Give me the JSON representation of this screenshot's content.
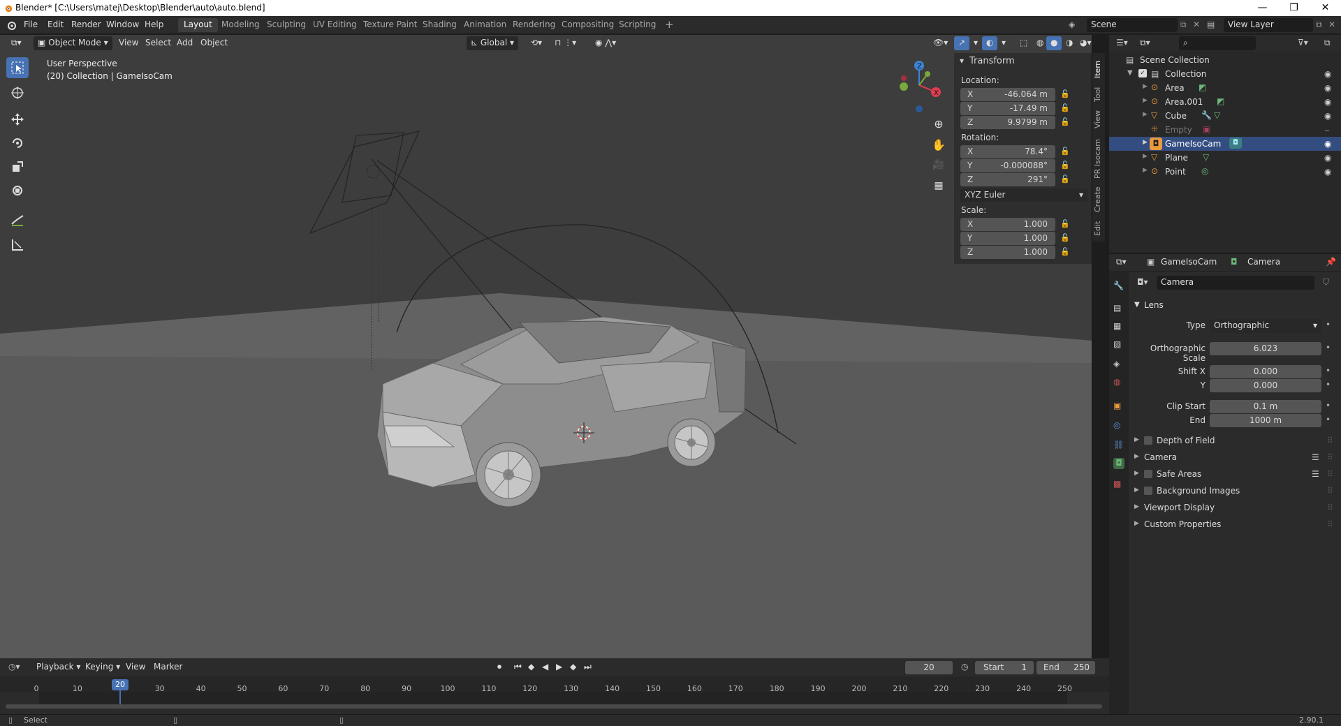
{
  "window": {
    "title": "Blender* [C:\\Users\\matej\\Desktop\\Blender\\auto\\auto.blend]"
  },
  "menus": [
    "File",
    "Edit",
    "Render",
    "Window",
    "Help"
  ],
  "workspaces": [
    "Layout",
    "Modeling",
    "Sculpting",
    "UV Editing",
    "Texture Paint",
    "Shading",
    "Animation",
    "Rendering",
    "Compositing",
    "Scripting"
  ],
  "scene": {
    "label": "Scene",
    "view_layer": "View Layer"
  },
  "viewport": {
    "mode": "Object Mode",
    "menus": [
      "View",
      "Select",
      "Add",
      "Object"
    ],
    "orientation": "Global",
    "overlay_line1": "User Perspective",
    "overlay_line2": "(20) Collection | GameIsoCam",
    "gizmo_axes": [
      "X",
      "Y",
      "Z"
    ]
  },
  "npanel": {
    "title": "Transform",
    "location_label": "Location:",
    "location": [
      {
        "axis": "X",
        "value": "-46.064 m"
      },
      {
        "axis": "Y",
        "value": "-17.49 m"
      },
      {
        "axis": "Z",
        "value": "9.9799 m"
      }
    ],
    "rotation_label": "Rotation:",
    "rotation": [
      {
        "axis": "X",
        "value": "78.4°"
      },
      {
        "axis": "Y",
        "value": "-0.000088°"
      },
      {
        "axis": "Z",
        "value": "291°"
      }
    ],
    "rotation_mode": "XYZ Euler",
    "scale_label": "Scale:",
    "scale": [
      {
        "axis": "X",
        "value": "1.000"
      },
      {
        "axis": "Y",
        "value": "1.000"
      },
      {
        "axis": "Z",
        "value": "1.000"
      }
    ],
    "tabs": [
      "Item",
      "Tool",
      "View",
      "PR Isocam",
      "Create",
      "Edit"
    ]
  },
  "outliner": {
    "root": "Scene Collection",
    "collection": "Collection",
    "items": [
      {
        "name": "Area"
      },
      {
        "name": "Area.001"
      },
      {
        "name": "Cube"
      },
      {
        "name": "Empty"
      },
      {
        "name": "GameIsoCam"
      },
      {
        "name": "Plane"
      },
      {
        "name": "Point"
      }
    ]
  },
  "properties": {
    "object_name": "GameIsoCam",
    "data_tab": "Camera",
    "datablock": "Camera",
    "lens_header": "Lens",
    "type_label": "Type",
    "type_value": "Orthographic",
    "ortho_scale_label": "Orthographic Scale",
    "ortho_scale_value": "6.023",
    "shift_x_label": "Shift X",
    "shift_x_value": "0.000",
    "shift_y_label": "Y",
    "shift_y_value": "0.000",
    "clip_start_label": "Clip Start",
    "clip_start_value": "0.1 m",
    "clip_end_label": "End",
    "clip_end_value": "1000 m",
    "panels": [
      "Depth of Field",
      "Camera",
      "Safe Areas",
      "Background Images",
      "Viewport Display",
      "Custom Properties"
    ]
  },
  "timeline": {
    "menus": [
      "Playback",
      "Keying",
      "View",
      "Marker"
    ],
    "current_frame": "20",
    "start_label": "Start",
    "start": "1",
    "end_label": "End",
    "end": "250",
    "ticks": [
      "0",
      "10",
      "20",
      "30",
      "40",
      "50",
      "60",
      "70",
      "80",
      "90",
      "100",
      "110",
      "120",
      "130",
      "140",
      "150",
      "160",
      "170",
      "180",
      "190",
      "200",
      "210",
      "220",
      "230",
      "240",
      "250"
    ]
  },
  "status": {
    "left": "Select",
    "version": "2.90.1"
  },
  "colors": {
    "accent": "#4772b3",
    "selected_row": "#334d80",
    "viewport_bg": "#3d3d3d",
    "x_axis": "#e03c4f",
    "y_axis": "#7aa83a",
    "z_axis": "#3d83d6",
    "object_orange": "#e89a3d",
    "data_green": "#6fb779"
  }
}
